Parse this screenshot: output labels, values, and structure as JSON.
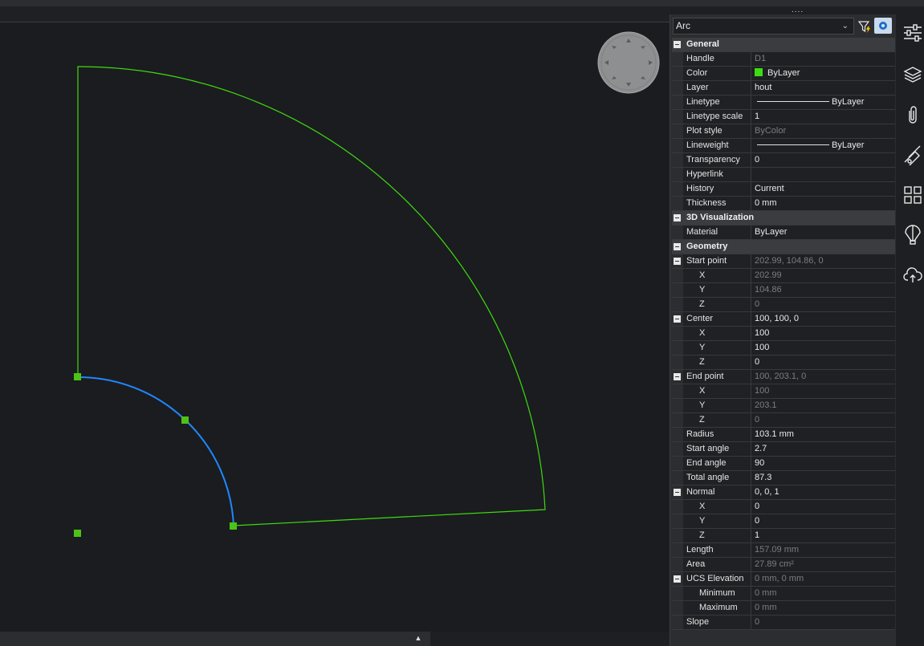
{
  "toolbar": {
    "drag_handle": "....",
    "scroll_up": "▲"
  },
  "properties": {
    "selected_type": "Arc",
    "sections": [
      {
        "name": "General",
        "rows": [
          {
            "name": "Handle",
            "value": "D1",
            "readonly": true
          },
          {
            "name": "Color",
            "value": "ByLayer",
            "swatch": "#3ddc11"
          },
          {
            "name": "Layer",
            "value": "hout"
          },
          {
            "name": "Linetype",
            "value": "ByLayer",
            "line": true
          },
          {
            "name": "Linetype scale",
            "value": "1"
          },
          {
            "name": "Plot style",
            "value": "ByColor",
            "readonly": true
          },
          {
            "name": "Lineweight",
            "value": "ByLayer",
            "line": true
          },
          {
            "name": "Transparency",
            "value": "0"
          },
          {
            "name": "Hyperlink",
            "value": ""
          },
          {
            "name": "History",
            "value": "Current"
          },
          {
            "name": "Thickness",
            "value": "0 mm"
          }
        ]
      },
      {
        "name": "3D Visualization",
        "rows": [
          {
            "name": "Material",
            "value": "ByLayer"
          }
        ]
      },
      {
        "name": "Geometry",
        "rows": [
          {
            "name": "Start point",
            "value": "202.99, 104.86, 0",
            "readonly": true,
            "group": true
          },
          {
            "name": "X",
            "value": "202.99",
            "readonly": true,
            "sub": true
          },
          {
            "name": "Y",
            "value": "104.86",
            "readonly": true,
            "sub": true
          },
          {
            "name": "Z",
            "value": "0",
            "readonly": true,
            "sub": true
          },
          {
            "name": "Center",
            "value": "100, 100, 0",
            "group": true
          },
          {
            "name": "X",
            "value": "100",
            "sub": true
          },
          {
            "name": "Y",
            "value": "100",
            "sub": true
          },
          {
            "name": "Z",
            "value": "0",
            "sub": true
          },
          {
            "name": "End point",
            "value": "100, 203.1, 0",
            "readonly": true,
            "group": true
          },
          {
            "name": "X",
            "value": "100",
            "readonly": true,
            "sub": true
          },
          {
            "name": "Y",
            "value": "203.1",
            "readonly": true,
            "sub": true
          },
          {
            "name": "Z",
            "value": "0",
            "readonly": true,
            "sub": true
          },
          {
            "name": "Radius",
            "value": "103.1 mm"
          },
          {
            "name": "Start angle",
            "value": "2.7"
          },
          {
            "name": "End angle",
            "value": "90"
          },
          {
            "name": "Total angle",
            "value": "87.3"
          },
          {
            "name": "Normal",
            "value": "0, 0, 1",
            "group": true
          },
          {
            "name": "X",
            "value": "0",
            "sub": true
          },
          {
            "name": "Y",
            "value": "0",
            "sub": true
          },
          {
            "name": "Z",
            "value": "1",
            "sub": true
          },
          {
            "name": "Length",
            "value": "157.09 mm",
            "readonly": true
          },
          {
            "name": "Area",
            "value": "27.89 cm²",
            "readonly": true
          },
          {
            "name": "UCS Elevation",
            "value": "0 mm, 0 mm",
            "readonly": true,
            "group": true
          },
          {
            "name": "Minimum",
            "value": "0 mm",
            "readonly": true,
            "sub": true
          },
          {
            "name": "Maximum",
            "value": "0 mm",
            "readonly": true,
            "sub": true
          },
          {
            "name": "Slope",
            "value": "0",
            "readonly": true
          }
        ]
      }
    ]
  },
  "side_icons": [
    "properties-icon",
    "layers-icon",
    "attachments-icon",
    "draw-order-icon",
    "blocks-icon",
    "render-icon",
    "cloud-upload-icon"
  ],
  "colors": {
    "outline": "#3ddc11",
    "selected_arc": "#1e88ff",
    "grip": "#4cc417"
  }
}
